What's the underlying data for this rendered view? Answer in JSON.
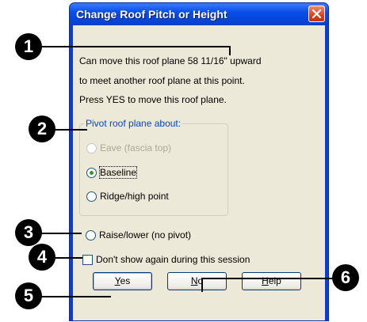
{
  "dialog": {
    "title": "Change Roof Pitch or Height",
    "message_lines": [
      "Can move this roof plane 58 11/16\" upward",
      "to meet another roof plane at this point.",
      "Press YES to move this roof plane."
    ],
    "pivot_group": {
      "legend": "Pivot roof plane about:",
      "options": [
        {
          "label": "Eave (fascia top)",
          "selected": false,
          "enabled": false
        },
        {
          "label": "Baseline",
          "selected": true,
          "enabled": true
        },
        {
          "label": "Ridge/high point",
          "selected": false,
          "enabled": true
        }
      ]
    },
    "raise_option": {
      "label": "Raise/lower (no pivot)",
      "selected": false
    },
    "dont_show_checkbox": {
      "label": "Don't show again during this session",
      "checked": false
    },
    "buttons": {
      "yes": {
        "underline": "Y",
        "rest": "es"
      },
      "no": {
        "underline": "N",
        "rest": "o"
      },
      "help": {
        "underline": "H",
        "rest": "elp"
      }
    }
  },
  "callouts": [
    "1",
    "2",
    "3",
    "4",
    "5",
    "6"
  ],
  "colors": {
    "titlebar": "#0646dc",
    "client": "#ece9d8",
    "legend_text": "#0046d5",
    "close_button": "#d6431b"
  },
  "icons": {
    "close": "close-x-icon"
  }
}
